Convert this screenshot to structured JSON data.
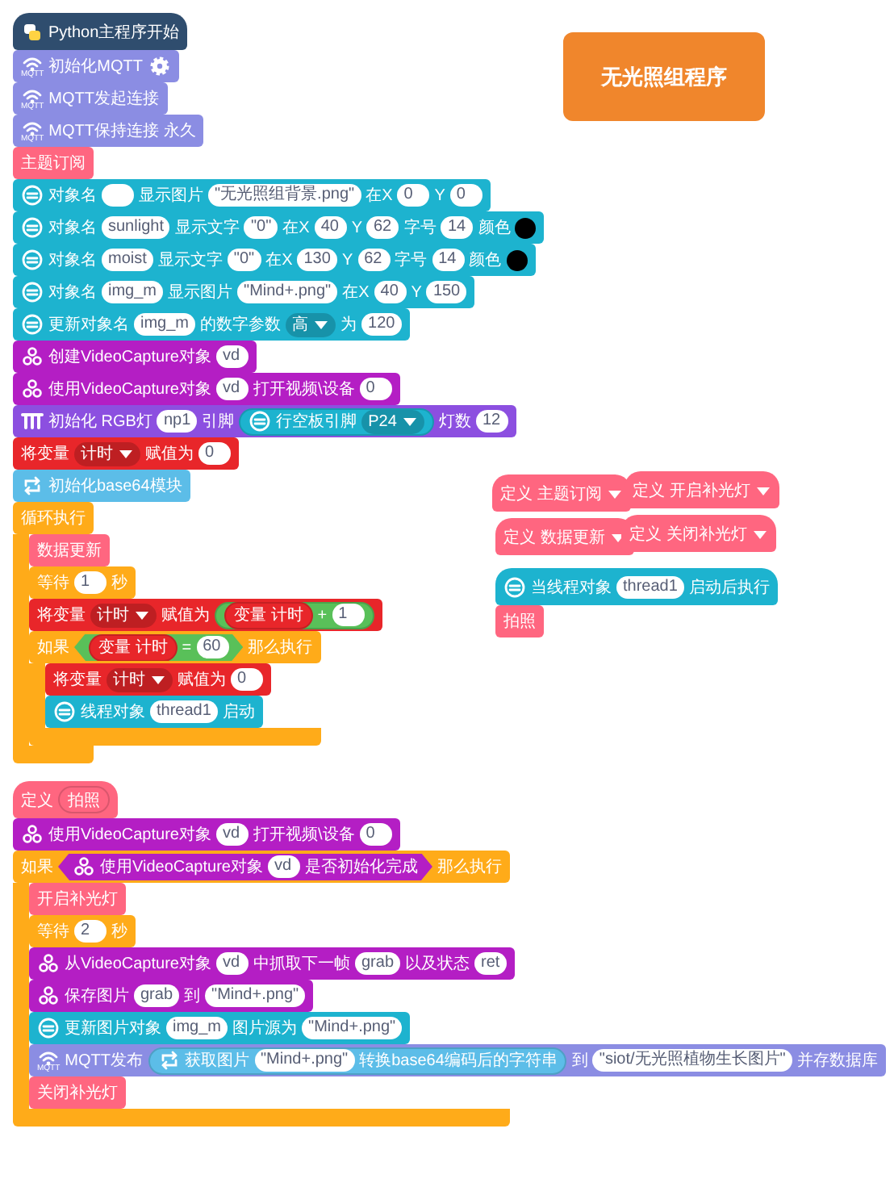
{
  "badge": {
    "text": "无光照组程序"
  },
  "stacks": [
    {
      "hat": {
        "kind": "python",
        "parts": [
          {
            "kind": "text",
            "text": "Python主程序开始"
          }
        ]
      },
      "blocks": [
        {
          "kind": "mqtt",
          "icon_caption": "MQTT",
          "parts": [
            {
              "kind": "text",
              "text": "初始化MQTT"
            },
            {
              "kind": "gear"
            }
          ]
        },
        {
          "kind": "mqtt",
          "icon_caption": "MQTT",
          "parts": [
            {
              "kind": "text",
              "text": "MQTT发起连接"
            }
          ]
        },
        {
          "kind": "mqtt",
          "icon_caption": "MQTT",
          "parts": [
            {
              "kind": "text",
              "text": "MQTT保持连接 永久"
            }
          ]
        },
        {
          "kind": "func",
          "parts": [
            {
              "kind": "text",
              "text": "主题订阅"
            }
          ]
        },
        {
          "kind": "unihiker",
          "parts": [
            {
              "kind": "text",
              "text": "对象名"
            },
            {
              "kind": "input"
            },
            {
              "kind": "text",
              "text": "显示图片"
            },
            {
              "kind": "string",
              "text": "\"无光照组背景.png\""
            },
            {
              "kind": "text",
              "text": "在X"
            },
            {
              "kind": "input",
              "text": "0"
            },
            {
              "kind": "text",
              "text": "Y"
            },
            {
              "kind": "input",
              "text": "0"
            }
          ]
        },
        {
          "kind": "unihiker",
          "parts": [
            {
              "kind": "text",
              "text": "对象名"
            },
            {
              "kind": "input",
              "text": "sunlight"
            },
            {
              "kind": "text",
              "text": "显示文字"
            },
            {
              "kind": "string",
              "text": "\"0\""
            },
            {
              "kind": "text",
              "text": "在X"
            },
            {
              "kind": "input",
              "text": "40"
            },
            {
              "kind": "text",
              "text": "Y"
            },
            {
              "kind": "input",
              "text": "62"
            },
            {
              "kind": "text",
              "text": "字号"
            },
            {
              "kind": "input",
              "text": "14"
            },
            {
              "kind": "text",
              "text": "颜色"
            },
            {
              "kind": "color",
              "color": "#000000"
            }
          ]
        },
        {
          "kind": "unihiker",
          "parts": [
            {
              "kind": "text",
              "text": "对象名"
            },
            {
              "kind": "input",
              "text": "moist"
            },
            {
              "kind": "text",
              "text": "显示文字"
            },
            {
              "kind": "string",
              "text": "\"0\""
            },
            {
              "kind": "text",
              "text": "在X"
            },
            {
              "kind": "input",
              "text": "130"
            },
            {
              "kind": "text",
              "text": "Y"
            },
            {
              "kind": "input",
              "text": "62"
            },
            {
              "kind": "text",
              "text": "字号"
            },
            {
              "kind": "input",
              "text": "14"
            },
            {
              "kind": "text",
              "text": "颜色"
            },
            {
              "kind": "color",
              "color": "#000000"
            }
          ]
        },
        {
          "kind": "unihiker",
          "parts": [
            {
              "kind": "text",
              "text": "对象名"
            },
            {
              "kind": "input",
              "text": "img_m"
            },
            {
              "kind": "text",
              "text": "显示图片"
            },
            {
              "kind": "string",
              "text": "\"Mind+.png\""
            },
            {
              "kind": "text",
              "text": "在X"
            },
            {
              "kind": "input",
              "text": "40"
            },
            {
              "kind": "text",
              "text": "Y"
            },
            {
              "kind": "input",
              "text": "150"
            }
          ]
        },
        {
          "kind": "unihiker",
          "parts": [
            {
              "kind": "text",
              "text": "更新对象名"
            },
            {
              "kind": "input",
              "text": "img_m"
            },
            {
              "kind": "text",
              "text": "的数字参数"
            },
            {
              "kind": "dropdown",
              "text": "高"
            },
            {
              "kind": "text",
              "text": "为"
            },
            {
              "kind": "input",
              "text": "120"
            }
          ]
        },
        {
          "kind": "opencv",
          "parts": [
            {
              "kind": "text",
              "text": "创建VideoCapture对象"
            },
            {
              "kind": "input",
              "text": "vd"
            }
          ]
        },
        {
          "kind": "opencv",
          "parts": [
            {
              "kind": "text",
              "text": "使用VideoCapture对象"
            },
            {
              "kind": "input",
              "text": "vd"
            },
            {
              "kind": "text",
              "text": "打开视频\\设备"
            },
            {
              "kind": "input",
              "text": "0"
            }
          ]
        },
        {
          "kind": "rgb",
          "parts": [
            {
              "kind": "text",
              "text": "初始化 RGB灯"
            },
            {
              "kind": "input",
              "text": "np1"
            },
            {
              "kind": "text",
              "text": "引脚"
            },
            {
              "kind": "reporter",
              "block": {
                "kind": "unihiker",
                "parts": [
                  {
                    "kind": "text",
                    "text": "行空板引脚"
                  },
                  {
                    "kind": "dropdown",
                    "text": "P24"
                  }
                ]
              }
            },
            {
              "kind": "text",
              "text": "灯数"
            },
            {
              "kind": "input",
              "text": "12"
            }
          ]
        },
        {
          "kind": "variable",
          "parts": [
            {
              "kind": "text",
              "text": "将变量"
            },
            {
              "kind": "dropdown",
              "text": "计时"
            },
            {
              "kind": "text",
              "text": "赋值为"
            },
            {
              "kind": "input",
              "text": "0"
            }
          ]
        },
        {
          "kind": "base64",
          "parts": [
            {
              "kind": "text",
              "text": "初始化base64模块"
            }
          ]
        },
        {
          "kind": "control",
          "parts": [
            {
              "kind": "text",
              "text": "循环执行"
            }
          ],
          "children": [
            {
              "kind": "func",
              "parts": [
                {
                  "kind": "text",
                  "text": "数据更新"
                }
              ]
            },
            {
              "kind": "control",
              "parts": [
                {
                  "kind": "text",
                  "text": "等待"
                },
                {
                  "kind": "input",
                  "text": "1"
                },
                {
                  "kind": "text",
                  "text": "秒"
                }
              ]
            },
            {
              "kind": "variable",
              "parts": [
                {
                  "kind": "text",
                  "text": "将变量"
                },
                {
                  "kind": "dropdown",
                  "text": "计时"
                },
                {
                  "kind": "text",
                  "text": "赋值为"
                },
                {
                  "kind": "reporter",
                  "block": {
                    "kind": "operator",
                    "parts": [
                      {
                        "kind": "reporter",
                        "block": {
                          "kind": "variable",
                          "parts": [
                            {
                              "kind": "text",
                              "text": "变量 计时"
                            }
                          ]
                        }
                      },
                      {
                        "kind": "text",
                        "text": "+"
                      },
                      {
                        "kind": "input",
                        "text": "1"
                      }
                    ]
                  }
                }
              ]
            },
            {
              "kind": "control",
              "parts": [
                {
                  "kind": "text",
                  "text": "如果"
                },
                {
                  "kind": "boolean",
                  "block": {
                    "kind": "operator",
                    "parts": [
                      {
                        "kind": "reporter",
                        "block": {
                          "kind": "variable",
                          "parts": [
                            {
                              "kind": "text",
                              "text": "变量 计时"
                            }
                          ]
                        }
                      },
                      {
                        "kind": "text",
                        "text": "="
                      },
                      {
                        "kind": "input",
                        "text": "60"
                      }
                    ]
                  }
                },
                {
                  "kind": "text",
                  "text": "那么执行"
                }
              ],
              "children": [
                {
                  "kind": "variable",
                  "parts": [
                    {
                      "kind": "text",
                      "text": "将变量"
                    },
                    {
                      "kind": "dropdown",
                      "text": "计时"
                    },
                    {
                      "kind": "text",
                      "text": "赋值为"
                    },
                    {
                      "kind": "input",
                      "text": "0"
                    }
                  ]
                },
                {
                  "kind": "unihiker",
                  "parts": [
                    {
                      "kind": "text",
                      "text": "线程对象"
                    },
                    {
                      "kind": "input",
                      "text": "thread1"
                    },
                    {
                      "kind": "text",
                      "text": "启动"
                    }
                  ]
                }
              ]
            }
          ]
        }
      ]
    },
    {
      "hat": {
        "kind": "func",
        "parts": [
          {
            "kind": "text",
            "text": "定义"
          },
          {
            "kind": "menu",
            "text": "主题订阅"
          }
        ]
      }
    },
    {
      "hat": {
        "kind": "func",
        "parts": [
          {
            "kind": "text",
            "text": "定义"
          },
          {
            "kind": "menu",
            "text": "开启补光灯"
          }
        ]
      }
    },
    {
      "hat": {
        "kind": "func",
        "parts": [
          {
            "kind": "text",
            "text": "定义"
          },
          {
            "kind": "menu",
            "text": "数据更新"
          }
        ]
      }
    },
    {
      "hat": {
        "kind": "func",
        "parts": [
          {
            "kind": "text",
            "text": "定义"
          },
          {
            "kind": "menu",
            "text": "关闭补光灯"
          }
        ]
      }
    },
    {
      "hat": {
        "kind": "unihiker",
        "parts": [
          {
            "kind": "text",
            "text": "当线程对象"
          },
          {
            "kind": "input",
            "text": "thread1"
          },
          {
            "kind": "text",
            "text": "启动后执行"
          }
        ]
      },
      "blocks": [
        {
          "kind": "func",
          "parts": [
            {
              "kind": "text",
              "text": "拍照"
            }
          ]
        }
      ]
    },
    {
      "hat": {
        "kind": "func",
        "parts": [
          {
            "kind": "text",
            "text": "定义"
          },
          {
            "kind": "reporter",
            "block": {
              "kind": "func",
              "parts": [
                {
                  "kind": "text",
                  "text": "拍照"
                }
              ]
            }
          }
        ]
      },
      "blocks": [
        {
          "kind": "opencv",
          "parts": [
            {
              "kind": "text",
              "text": "使用VideoCapture对象"
            },
            {
              "kind": "input",
              "text": "vd"
            },
            {
              "kind": "text",
              "text": "打开视频\\设备"
            },
            {
              "kind": "input",
              "text": "0"
            }
          ]
        },
        {
          "kind": "control",
          "parts": [
            {
              "kind": "text",
              "text": "如果"
            },
            {
              "kind": "boolean",
              "block": {
                "kind": "opencv",
                "parts": [
                  {
                    "kind": "text",
                    "text": "使用VideoCapture对象"
                  },
                  {
                    "kind": "input",
                    "text": "vd"
                  },
                  {
                    "kind": "text",
                    "text": "是否初始化完成"
                  }
                ]
              }
            },
            {
              "kind": "text",
              "text": "那么执行"
            }
          ],
          "children": [
            {
              "kind": "func",
              "parts": [
                {
                  "kind": "text",
                  "text": "开启补光灯"
                }
              ]
            },
            {
              "kind": "control",
              "parts": [
                {
                  "kind": "text",
                  "text": "等待"
                },
                {
                  "kind": "input",
                  "text": "2"
                },
                {
                  "kind": "text",
                  "text": "秒"
                }
              ]
            },
            {
              "kind": "opencv",
              "parts": [
                {
                  "kind": "text",
                  "text": "从VideoCapture对象"
                },
                {
                  "kind": "input",
                  "text": "vd"
                },
                {
                  "kind": "text",
                  "text": "中抓取下一帧"
                },
                {
                  "kind": "input",
                  "text": "grab"
                },
                {
                  "kind": "text",
                  "text": "以及状态"
                },
                {
                  "kind": "input",
                  "text": "ret"
                }
              ]
            },
            {
              "kind": "opencv",
              "parts": [
                {
                  "kind": "text",
                  "text": "保存图片"
                },
                {
                  "kind": "input",
                  "text": "grab"
                },
                {
                  "kind": "text",
                  "text": "到"
                },
                {
                  "kind": "string",
                  "text": "\"Mind+.png\""
                }
              ]
            },
            {
              "kind": "unihiker",
              "parts": [
                {
                  "kind": "text",
                  "text": "更新图片对象"
                },
                {
                  "kind": "input",
                  "text": "img_m"
                },
                {
                  "kind": "text",
                  "text": "图片源为"
                },
                {
                  "kind": "string",
                  "text": "\"Mind+.png\""
                }
              ]
            },
            {
              "kind": "mqtt",
              "icon_caption": "MQTT",
              "parts": [
                {
                  "kind": "text",
                  "text": "MQTT发布"
                },
                {
                  "kind": "reporter",
                  "block": {
                    "kind": "base64",
                    "parts": [
                      {
                        "kind": "text",
                        "text": "获取图片"
                      },
                      {
                        "kind": "string",
                        "text": "\"Mind+.png\""
                      },
                      {
                        "kind": "text",
                        "text": "转换base64编码后的字符串"
                      }
                    ]
                  }
                },
                {
                  "kind": "text",
                  "text": "到"
                },
                {
                  "kind": "string",
                  "text": "\"siot/无光照植物生长图片\""
                },
                {
                  "kind": "text",
                  "text": "并存数据库"
                }
              ]
            },
            {
              "kind": "func",
              "parts": [
                {
                  "kind": "text",
                  "text": "关闭补光灯"
                }
              ]
            }
          ]
        }
      ]
    }
  ]
}
